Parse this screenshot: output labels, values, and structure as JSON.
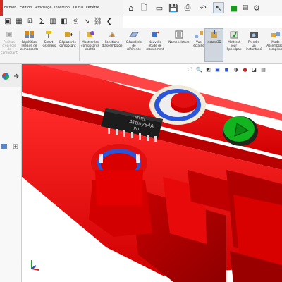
{
  "menu": {
    "items": [
      "Fichier",
      "Edition",
      "Affichage",
      "Insertion",
      "Outils",
      "Fenêtre"
    ]
  },
  "quick_access": {
    "icons": [
      "home-icon",
      "new-document-icon",
      "open-icon",
      "save-icon",
      "print-icon",
      "undo-icon",
      "select-icon",
      "rebuild-icon",
      "options-icon"
    ]
  },
  "command_manager": {
    "commands": [
      {
        "label": "Position\nd'épingle\nde\ncomposant",
        "disabled": true,
        "icon": "pin-icon"
      },
      {
        "label": "Répétition\nlinéaire de\ncomposants",
        "disabled": false,
        "icon": "linear-pattern-icon"
      },
      {
        "label": "Smart\nFasteners",
        "disabled": false,
        "icon": "fastener-icon"
      },
      {
        "label": "Déplacer le\ncomposant",
        "disabled": false,
        "icon": "move-component-icon"
      },
      {
        "label": "Montrer les\ncomposants\ncachés",
        "disabled": false,
        "icon": "show-hidden-icon"
      },
      {
        "label": "Fonctions\nd'assemblage",
        "disabled": false,
        "icon": "assembly-features-icon"
      },
      {
        "label": "Géométrie\nde\nréférence",
        "disabled": false,
        "icon": "reference-geometry-icon"
      },
      {
        "label": "Nouvelle\nétude de\nmouvement",
        "disabled": false,
        "icon": "motion-study-icon"
      },
      {
        "label": "Nomenclature",
        "disabled": false,
        "icon": "bom-icon"
      },
      {
        "label": "Vue\néclatée",
        "disabled": false,
        "icon": "exploded-view-icon"
      },
      {
        "label": "Instant3D",
        "disabled": false,
        "icon": "instant3d-icon"
      },
      {
        "label": "Mettre à\njour\nSpeedpak",
        "disabled": false,
        "icon": "speedpak-icon"
      },
      {
        "label": "Prendre\nun\ninstantané",
        "disabled": false,
        "icon": "snapshot-icon"
      },
      {
        "label": "Mode\nAssemblage\ncomplexe",
        "disabled": false,
        "icon": "large-assembly-icon"
      }
    ]
  },
  "chip": {
    "line1": "ATMEL",
    "line2": "ATtiny84A",
    "line3": "PU"
  },
  "colors": {
    "part_red": "#e00000",
    "ring_blue": "#2b55d8",
    "button_green": "#12b520",
    "chip_black": "#1c1c1c"
  }
}
